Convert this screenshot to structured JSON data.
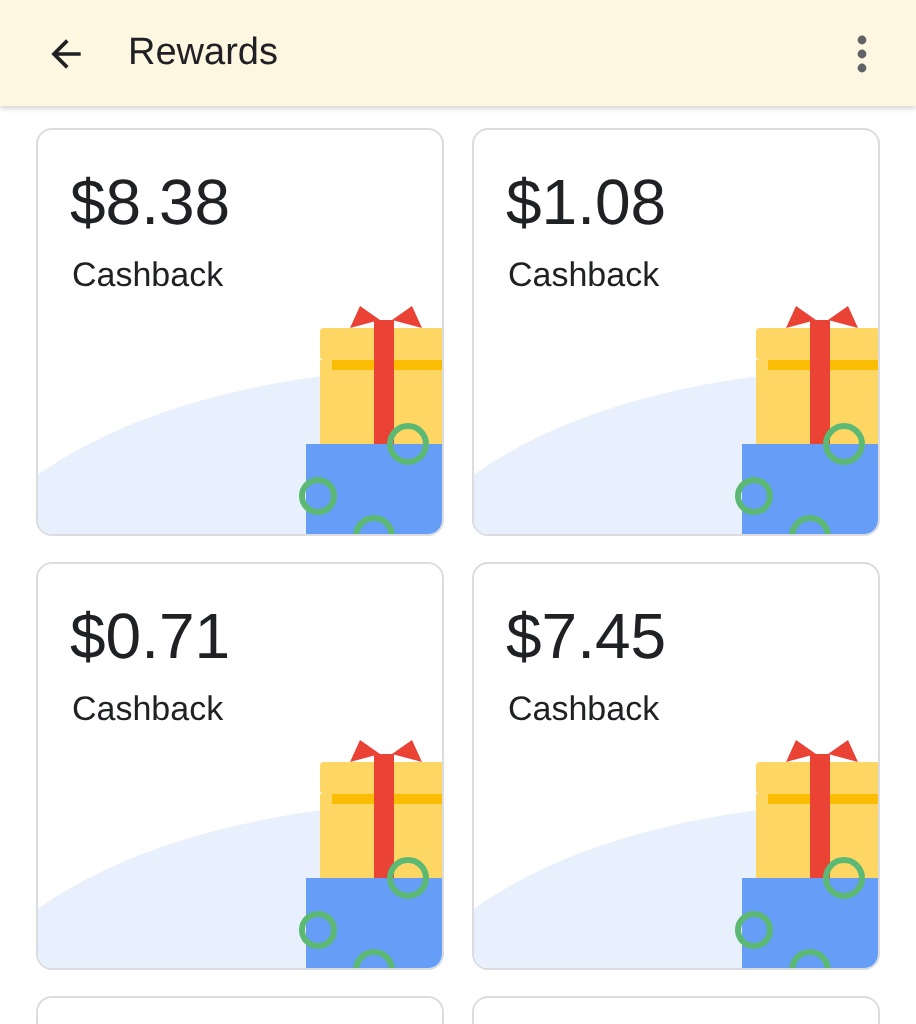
{
  "app_bar": {
    "title": "Rewards"
  },
  "cards": [
    {
      "kind": "reward",
      "amount": "$8.38",
      "label": "Cashback"
    },
    {
      "kind": "reward",
      "amount": "$1.08",
      "label": "Cashback"
    },
    {
      "kind": "reward",
      "amount": "$0.71",
      "label": "Cashback"
    },
    {
      "kind": "reward",
      "amount": "$7.45",
      "label": "Cashback"
    },
    {
      "kind": "cut-off"
    },
    {
      "kind": "cut-off"
    }
  ]
}
